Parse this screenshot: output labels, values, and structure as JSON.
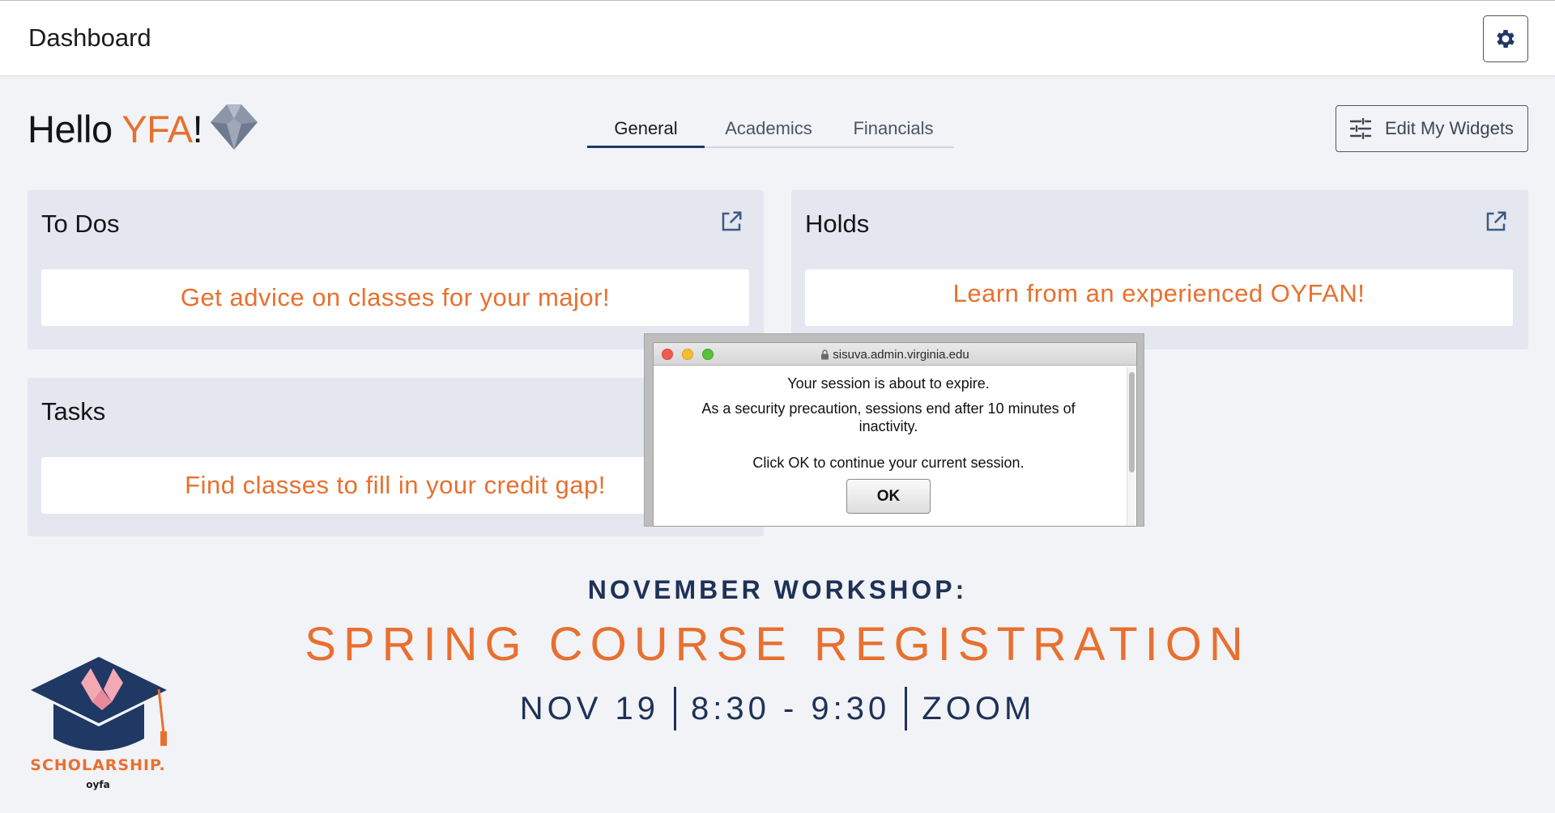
{
  "header": {
    "title": "Dashboard",
    "settings_icon": "gear-icon"
  },
  "greeting": {
    "hello": "Hello",
    "name": "YFA",
    "exclaim": "!"
  },
  "tabs": [
    {
      "label": "General",
      "active": true
    },
    {
      "label": "Academics",
      "active": false
    },
    {
      "label": "Financials",
      "active": false
    }
  ],
  "edit_widgets": {
    "label": "Edit My Widgets",
    "icon": "sliders-icon"
  },
  "cards": {
    "todos": {
      "title": "To Dos",
      "content": "Get advice on classes for your major!"
    },
    "holds": {
      "title": "Holds",
      "content": "Learn from an experienced OYFAN!"
    },
    "tasks": {
      "title": "Tasks",
      "content": "Find classes to fill in your credit gap!"
    }
  },
  "promo": {
    "kicker": "NOVEMBER WORKSHOP:",
    "title": "SPRING COURSE REGISTRATION",
    "date": "NOV 19",
    "time": "8:30 - 9:30",
    "location": "ZOOM"
  },
  "scholarship_logo": {
    "name": "SCHOLARSHIP.",
    "sub": "oyfa"
  },
  "session_popup": {
    "url": "sisuva.admin.virginia.edu",
    "line1": "Your session is about to expire.",
    "line2": "As a security precaution, sessions end after 10 minutes of inactivity.",
    "line3": "Click OK to continue your current session.",
    "ok_label": "OK"
  },
  "colors": {
    "accent": "#e8702f",
    "navy": "#1e3157",
    "background": "#f1f3f7",
    "card": "#e4e7ef"
  }
}
